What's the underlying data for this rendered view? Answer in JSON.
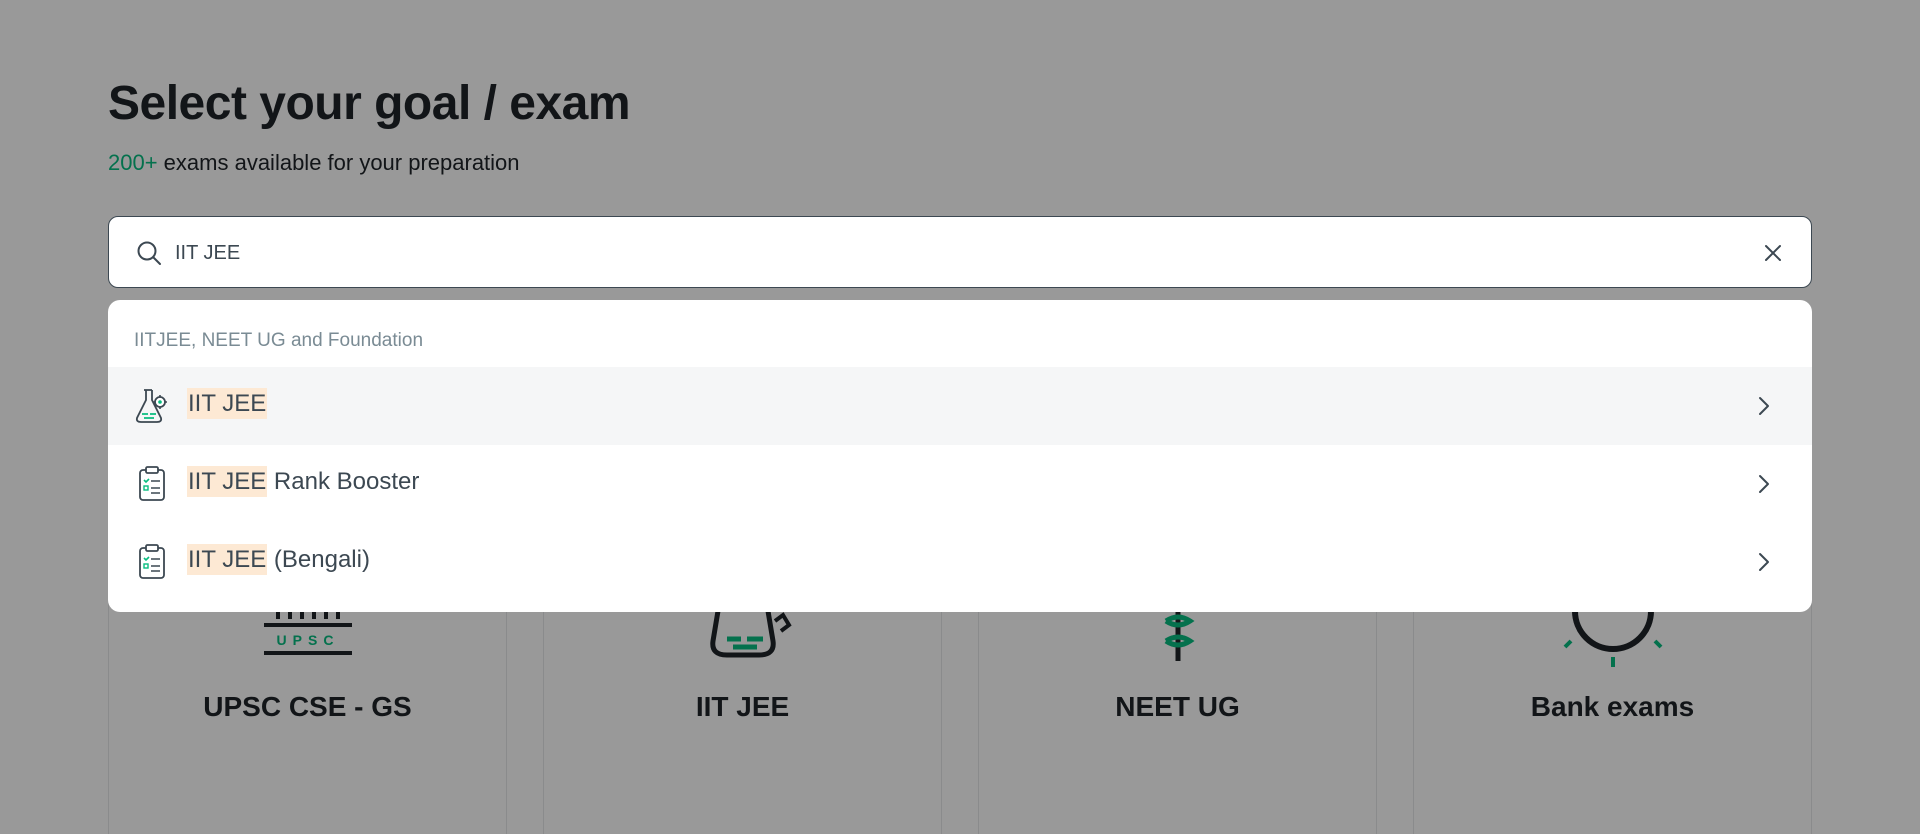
{
  "header": {
    "title": "Select your goal / exam",
    "subtitle_count": "200+",
    "subtitle_rest": " exams available for your preparation"
  },
  "search": {
    "value": "IIT JEE",
    "placeholder": ""
  },
  "dropdown": {
    "group_label": "IITJEE, NEET UG and Foundation",
    "results": [
      {
        "match": "IIT JEE",
        "rest": "",
        "icon": "flask-gear-icon"
      },
      {
        "match": "IIT JEE",
        "rest": " Rank Booster",
        "icon": "clipboard-checklist-icon"
      },
      {
        "match": "IIT JEE",
        "rest": " (Bengali)",
        "icon": "clipboard-checklist-icon"
      }
    ]
  },
  "cards": [
    {
      "label": "UPSC CSE - GS",
      "icon": "upsc-building-icon"
    },
    {
      "label": "IIT JEE",
      "icon": "flask-icon"
    },
    {
      "label": "NEET UG",
      "icon": "caduceus-icon"
    },
    {
      "label": "Bank exams",
      "icon": "bank-icon"
    }
  ],
  "colors": {
    "accent": "#08bd80",
    "text_dark": "#1f2328",
    "text_muted": "#7a8b94",
    "match_highlight": "#fde9d4"
  }
}
